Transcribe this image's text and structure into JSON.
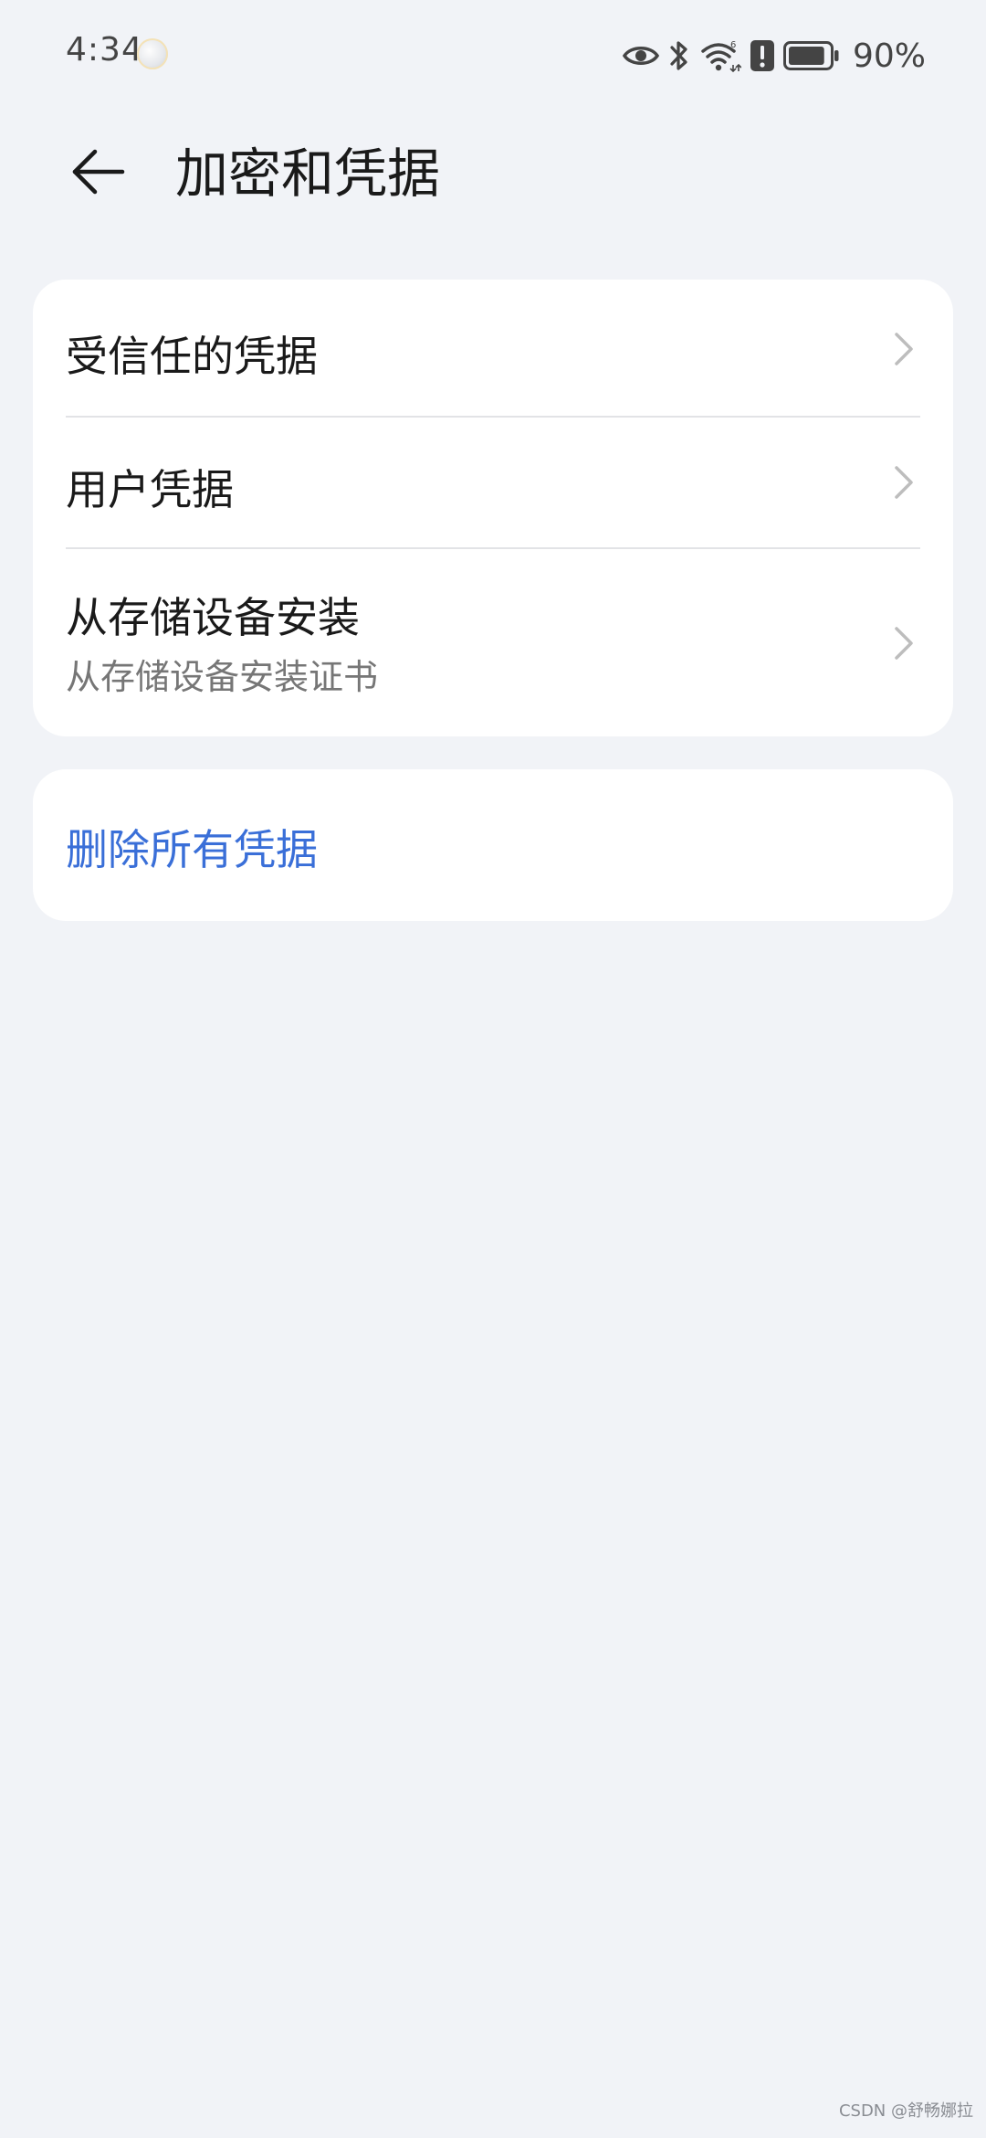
{
  "status_bar": {
    "time": "4:34",
    "weather_icon": "cloudy-moon-icon",
    "icons": [
      "eye-icon",
      "bluetooth-icon",
      "wifi-icon",
      "alert-icon",
      "battery-icon"
    ],
    "battery_percent": "90%",
    "battery_level": 0.9
  },
  "header": {
    "back_icon": "back-arrow-icon",
    "title": "加密和凭据"
  },
  "settings": {
    "items": [
      {
        "label": "受信任的凭据",
        "sublabel": ""
      },
      {
        "label": "用户凭据",
        "sublabel": ""
      },
      {
        "label": "从存储设备安装",
        "sublabel": "从存储设备安装证书"
      }
    ]
  },
  "actions": {
    "delete_all_label": "删除所有凭据"
  },
  "watermark": "CSDN @舒畅娜拉",
  "colors": {
    "background": "#f1f3f7",
    "card": "#ffffff",
    "accent": "#3a6fd8",
    "primary_text": "#1a1a1a",
    "secondary_text": "#767676"
  }
}
